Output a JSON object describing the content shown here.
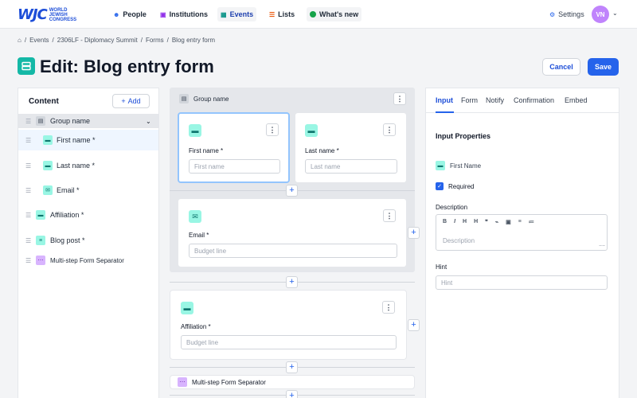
{
  "brand": {
    "mark": "WJC",
    "name": "WORLD JEWISH CONGRESS",
    "accent": "#2563eb",
    "teal": "#14b8a6"
  },
  "nav": {
    "items": [
      {
        "label": "People",
        "icon": "person-icon"
      },
      {
        "label": "Institutions",
        "icon": "building-icon"
      },
      {
        "label": "Events",
        "icon": "calendar-icon"
      },
      {
        "label": "Lists",
        "icon": "list-icon"
      },
      {
        "label": "What's new",
        "icon": "green-dot-icon"
      }
    ],
    "settings": "Settings",
    "avatar": "VN"
  },
  "breadcrumb": [
    "Events",
    "2306LF - Diplomacy Summit",
    "Forms",
    "Blog entry form"
  ],
  "page": {
    "title": "Edit: Blog entry form",
    "cancel": "Cancel",
    "save": "Save"
  },
  "content_panel": {
    "title": "Content",
    "add": "Add",
    "group": "Group name",
    "items": [
      {
        "label": "First name *",
        "icon": "text-field-icon"
      },
      {
        "label": "Last name *",
        "icon": "text-field-icon"
      },
      {
        "label": "Email *",
        "icon": "mail-icon"
      },
      {
        "label": "Affiliation *",
        "icon": "text-field-icon"
      },
      {
        "label": "Blog post *",
        "icon": "paragraph-icon"
      },
      {
        "label": "Multi-step Form Separator",
        "icon": "separator-icon"
      }
    ]
  },
  "canvas": {
    "group": "Group name",
    "fields": {
      "first_name": {
        "label": "First name *",
        "placeholder": "First name"
      },
      "last_name": {
        "label": "Last name *",
        "placeholder": "Last name"
      },
      "email": {
        "label": "Email *",
        "placeholder": "Budget line"
      },
      "affiliation": {
        "label": "Affiliation *",
        "placeholder": "Budget line"
      }
    },
    "separator": "Multi-step Form Separator"
  },
  "properties": {
    "tabs": [
      "Input",
      "Form",
      "Notify",
      "Confirmation",
      "Embed"
    ],
    "title": "Input Properties",
    "field_name": "First Name",
    "required": "Required",
    "description_label": "Description",
    "description_placeholder": "Description",
    "toolbar": [
      "B",
      "I",
      "H",
      "H",
      "❞",
      "⌁",
      "▣",
      "≡",
      "≔"
    ],
    "hint_label": "Hint",
    "hint_placeholder": "Hint"
  }
}
